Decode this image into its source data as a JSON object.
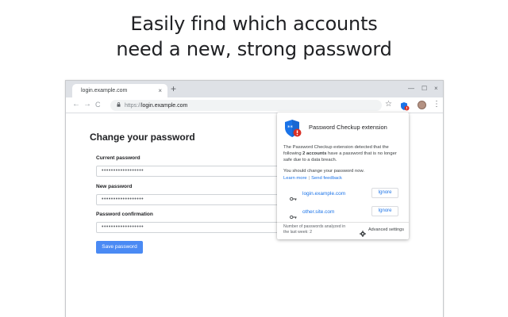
{
  "headline": {
    "line1": "Easily find which accounts",
    "line2": "need a new, strong password"
  },
  "browser": {
    "tab_title": "login.example.com",
    "tab_close": "×",
    "new_tab": "+",
    "window_controls": [
      "—",
      "☐",
      "×"
    ],
    "url_scheme": "https://",
    "url_host": "login.example.com",
    "back_icon": "←",
    "forward_icon": "→",
    "reload_icon": "C",
    "star_icon": "☆",
    "menu_icon": "⋮"
  },
  "form": {
    "title": "Change your password",
    "fields": [
      {
        "label": "Current password",
        "value": "••••••••••••••••••"
      },
      {
        "label": "New password",
        "value": "••••••••••••••••••"
      },
      {
        "label": "Password confirmation",
        "value": "••••••••••••••••••"
      }
    ],
    "save_label": "Save password"
  },
  "popup": {
    "title": "Password Checkup extension",
    "message_part1": "The Password Checkup extension detected that the following ",
    "message_bold": "2 accounts",
    "message_part2": " have a password that is no longer safe due to a data breach.",
    "advice": "You should change your password now.",
    "learn_more": "Learn more",
    "link_separator": "|",
    "send_feedback": "Send feedback",
    "accounts": [
      {
        "domain": "login.example.com",
        "action": "Ignore"
      },
      {
        "domain": "other.site.com",
        "action": "Ignore"
      }
    ],
    "footer_stats": "Number of passwords analyzed in the last week: 2",
    "advanced_settings": "Advanced settings"
  },
  "colors": {
    "accent": "#1a73e8",
    "button": "#4a8af4",
    "shield": "#1a73e8",
    "alert": "#d93025"
  }
}
